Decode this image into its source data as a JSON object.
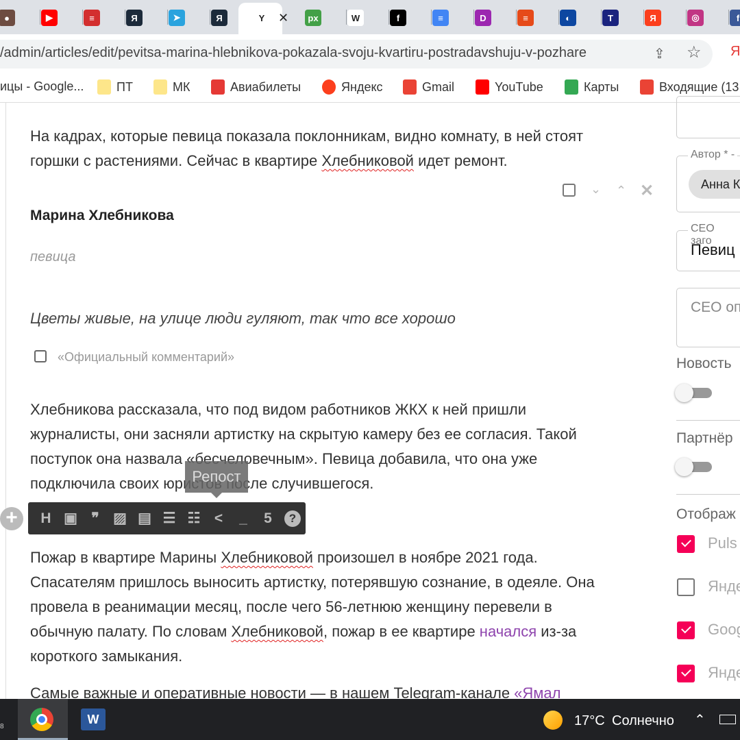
{
  "browser": {
    "tabs": [
      {
        "icon": "generic-icon",
        "color": "#6d4c41",
        "glyph": "●"
      },
      {
        "icon": "youtube-icon",
        "color": "#ff0000",
        "glyph": "▶"
      },
      {
        "icon": "news-icon",
        "color": "#d32f2f",
        "glyph": "≡"
      },
      {
        "icon": "yandex-icon",
        "color": "#1c2a3a",
        "glyph": "Я"
      },
      {
        "icon": "telegram-icon",
        "color": "#2aa3de",
        "glyph": "➤"
      },
      {
        "icon": "yandex-icon",
        "color": "#1c2a3a",
        "glyph": "Я"
      },
      {
        "icon": "site-icon",
        "color": "#ffffff",
        "glyph": "Y",
        "active": true
      },
      {
        "icon": "px-icon",
        "color": "#43a047",
        "glyph": "px"
      },
      {
        "icon": "wikipedia-icon",
        "color": "#ffffff",
        "glyph": "W"
      },
      {
        "icon": "f-icon",
        "color": "#000000",
        "glyph": "f"
      },
      {
        "icon": "docs-icon",
        "color": "#4285f4",
        "glyph": "≡"
      },
      {
        "icon": "d-icon",
        "color": "#9c27b0",
        "glyph": "D"
      },
      {
        "icon": "site-icon",
        "color": "#e64a19",
        "glyph": "≡"
      },
      {
        "icon": "globe-icon",
        "color": "#0d47a1",
        "glyph": "◐"
      },
      {
        "icon": "t-icon",
        "color": "#1a237e",
        "glyph": "T"
      },
      {
        "icon": "yandex-icon",
        "color": "#fc3f1d",
        "glyph": "Я"
      },
      {
        "icon": "instagram-icon",
        "color": "#c13584",
        "glyph": "◎"
      },
      {
        "icon": "facebook-icon",
        "color": "#3b5998",
        "glyph": "f"
      }
    ],
    "url": "/admin/articles/edit/pevitsa-marina-hlebnikova-pokazala-svoju-kvartiru-postradavshuju-v-pozhare",
    "bookmarks": [
      "ицы - Google...",
      "ПТ",
      "МК",
      "Авиабилеты",
      "Яндекс",
      "Gmail",
      "YouTube",
      "Карты",
      "Входящие (13"
    ]
  },
  "article": {
    "p1": [
      "На кадрах, которые певица показала поклонникам, видно комнату, в ней стоят",
      "горшки с растениями. Сейчас в квартире ",
      "Хлебниковой",
      " идет ремонт."
    ],
    "quote": {
      "author": "Марина Хлебникова",
      "role": "певица",
      "text": "Цветы живые, на улице люди гуляют, так что все хорошо",
      "official_label": "«Официальный комментарий»"
    },
    "p2": [
      "Хлебникова рассказала, что под видом работников ЖКХ к ней пришли",
      "журналисты, они засняли артистку на скрытую камеру без ее согласия. Такой",
      "поступок она назвала «бесчеловечным». Певица добавила, что она уже",
      "подключила своих юристов после случившегося."
    ],
    "p3": {
      "l1a": "Пожар в квартире Марины ",
      "l1b": "Хлебниковой",
      "l1c": " произошел в ноябре 2021 года.",
      "l2": "Спасателям пришлось выносить артистку, потерявшую сознание, в одеяле. Она",
      "l3": "провела в реанимации месяц, после чего 56-летнюю женщину перевели в",
      "l4a": "обычную палату. По словам ",
      "l4b": "Хлебниковой",
      "l4c": ", пожар в ее квартире ",
      "l4d": "начался",
      "l4e": " из-за",
      "l5": "короткого замыкания."
    },
    "p4": {
      "text": "Самые важные и оперативные новости — в нашем Telegram-канале ",
      "link": "«Ямал"
    },
    "tooltip": "Репост",
    "toolbar": [
      "heading-icon",
      "subheading-icon",
      "quote-icon",
      "image-icon",
      "gallery-icon",
      "bullet-list-icon",
      "numbered-list-icon",
      "share-icon",
      "divider-icon",
      "html5-icon",
      "help-icon"
    ]
  },
  "sidebar": {
    "author_label": "Автор * -",
    "author_value": "Анна К",
    "seo_title_label": "СЕО заго",
    "seo_title_value": "Певиц",
    "seo_desc_placeholder": "СЕО оп",
    "news_label": "Новость",
    "news_on": false,
    "partner_label": "Партнёр",
    "partner_on": false,
    "display_label": "Отображ",
    "display_options": [
      {
        "label": "Puls",
        "checked": true
      },
      {
        "label": "Янде",
        "checked": false
      },
      {
        "label": "Goog",
        "checked": true
      },
      {
        "label": "Янде",
        "checked": true
      }
    ],
    "accent": "#f50057"
  },
  "taskbar": {
    "badge": "8",
    "temperature": "17°C",
    "weather": "Солнечно"
  }
}
